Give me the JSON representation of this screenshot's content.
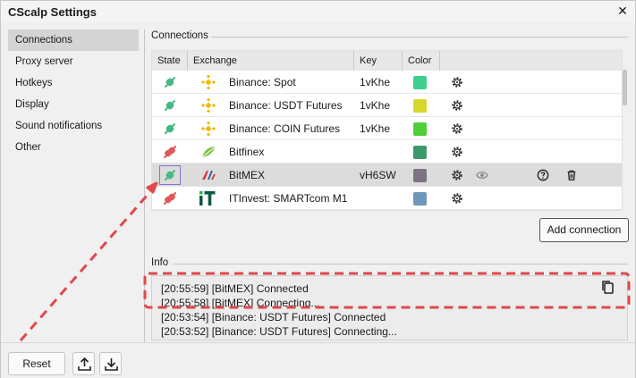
{
  "window": {
    "title": "CScalp Settings",
    "close_icon": "close-icon"
  },
  "sidebar": {
    "items": [
      {
        "label": "Connections",
        "active": true
      },
      {
        "label": "Proxy server"
      },
      {
        "label": "Hotkeys"
      },
      {
        "label": "Display"
      },
      {
        "label": "Sound notifications"
      },
      {
        "label": "Other"
      }
    ]
  },
  "connections": {
    "section_label": "Connections",
    "columns": {
      "state": "State",
      "exchange": "Exchange",
      "key": "Key",
      "color": "Color"
    },
    "rows": [
      {
        "state": "connected",
        "logo": "binance-logo",
        "exchange": "Binance: Spot",
        "key": "1vKhe",
        "color": "#3fcf8e"
      },
      {
        "state": "connected",
        "logo": "binance-logo",
        "exchange": "Binance: USDT Futures",
        "key": "1vKhe",
        "color": "#d6d62c"
      },
      {
        "state": "connected",
        "logo": "binance-logo",
        "exchange": "Binance: COIN Futures",
        "key": "1vKhe",
        "color": "#4ecf3a"
      },
      {
        "state": "disconnected",
        "logo": "bitfinex-logo",
        "exchange": "Bitfinex",
        "key": "",
        "color": "#3c9a6a"
      },
      {
        "state": "connected",
        "logo": "bitmex-logo",
        "exchange": "BitMEX",
        "key": "vH6SW",
        "color": "#7d7383",
        "selected": true
      },
      {
        "state": "disconnected",
        "logo": "itinvest-logo",
        "exchange": "ITInvest: SMARTcom M1",
        "key": "",
        "color": "#6f96bd"
      }
    ],
    "add_button": "Add connection"
  },
  "info": {
    "section_label": "Info",
    "lines": [
      "[20:55:59] [BitMEX] Connected",
      "[20:55:58] [BitMEX] Connecting...",
      "[20:53:54] [Binance: USDT Futures] Connected",
      "[20:53:52] [Binance: USDT Futures] Connecting..."
    ]
  },
  "footer": {
    "reset_label": "Reset",
    "import_icon": "upload-icon",
    "export_icon": "download-icon"
  },
  "colors": {
    "connected": "#48b884",
    "disconnected": "#e05a5a",
    "annotation": "#e0474c",
    "binance": "#f0b90b"
  }
}
